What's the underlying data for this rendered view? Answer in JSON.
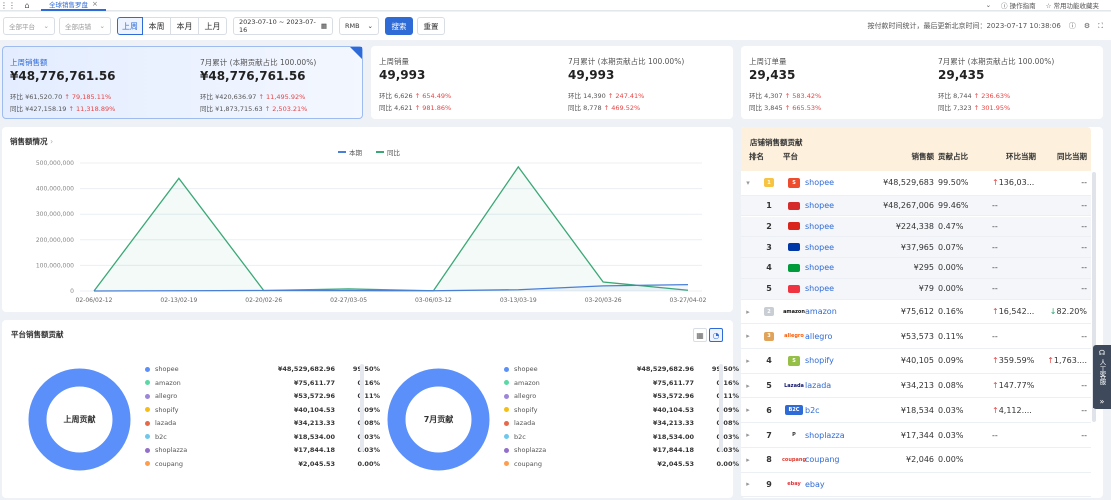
{
  "topbar": {
    "tab_title": "全球销售罗盘",
    "guide": "操作指南",
    "common_features": "常用功能收藏夹"
  },
  "filters": {
    "platform_placeholder": "全部平台",
    "shop_placeholder": "全部店铺",
    "periods": [
      "上周",
      "本周",
      "本月",
      "上月"
    ],
    "active_period": "上周",
    "date_range": "2023-07-10 ~ 2023-07-16",
    "currency": "RMB",
    "search": "搜索",
    "reset": "重置",
    "note": "按付款时间统计，最后更新北京时间：2023-07-17 10:38:06"
  },
  "kpis": [
    {
      "label": "上周销售额",
      "value": "¥48,776,761.56",
      "hb_label": "环比",
      "hb_prev": "¥61,520.70",
      "hb_change": "79,185.11%",
      "tb_label": "同比",
      "tb_prev": "¥427,158.19",
      "tb_change": "11,318.89%",
      "m_label": "7月累计 (本期贡献占比 100.00%)",
      "m_value": "¥48,776,761.56",
      "m_hb_prev": "¥420,636.97",
      "m_hb_change": "11,495.92%",
      "m_tb_prev": "¥1,873,715.63",
      "m_tb_change": "2,503.21%"
    },
    {
      "label": "上周销量",
      "value": "49,993",
      "hb_label": "环比",
      "hb_prev": "6,626",
      "hb_change": "654.49%",
      "tb_label": "同比",
      "tb_prev": "4,621",
      "tb_change": "981.86%",
      "m_label": "7月累计 (本期贡献占比 100.00%)",
      "m_value": "49,993",
      "m_hb_prev": "14,390",
      "m_hb_change": "247.41%",
      "m_tb_prev": "8,778",
      "m_tb_change": "469.52%"
    },
    {
      "label": "上周订单量",
      "value": "29,435",
      "hb_label": "环比",
      "hb_prev": "4,307",
      "hb_change": "583.42%",
      "tb_label": "同比",
      "tb_prev": "3,845",
      "tb_change": "665.53%",
      "m_label": "7月累计 (本期贡献占比 100.00%)",
      "m_value": "29,435",
      "m_hb_prev": "8,744",
      "m_hb_change": "236.63%",
      "m_tb_prev": "7,323",
      "m_tb_change": "301.95%"
    }
  ],
  "sales_chart": {
    "title": "销售额情况",
    "chart_data": {
      "type": "line",
      "x": [
        "02-06/02-12",
        "02-13/02-19",
        "02-20/02-26",
        "02-27/03-05",
        "03-06/03-12",
        "03-13/03-19",
        "03-20/03-26",
        "03-27/04-02"
      ],
      "ylim": [
        0,
        500000000
      ],
      "yticks": [
        "500,000,000",
        "400,000,000",
        "300,000,000",
        "200,000,000",
        "100,000,000",
        "0"
      ],
      "series": [
        {
          "name": "本期",
          "color": "#4a7fd6",
          "values": [
            0,
            1000000,
            2000000,
            1500000,
            1000000,
            5000000,
            20000000,
            25000000
          ]
        },
        {
          "name": "同比",
          "color": "#3aa876",
          "values": [
            0,
            440000000,
            2000000,
            8000000,
            1000000,
            485000000,
            35000000,
            3000000
          ]
        }
      ]
    }
  },
  "platform": {
    "title": "平台销售额贡献",
    "donut1_label": "上周贡献",
    "donut2_label": "7月贡献",
    "items": [
      {
        "name": "shopee",
        "color": "#5b8ff9",
        "amount": "¥48,529,682.96",
        "pct": "99.50%"
      },
      {
        "name": "amazon",
        "color": "#5ad8a6",
        "amount": "¥75,611.77",
        "pct": "0.16%"
      },
      {
        "name": "allegro",
        "color": "#9c86d9",
        "amount": "¥53,572.96",
        "pct": "0.11%"
      },
      {
        "name": "shopify",
        "color": "#f6bd16",
        "amount": "¥40,104.53",
        "pct": "0.09%"
      },
      {
        "name": "lazada",
        "color": "#e8684a",
        "amount": "¥34,213.33",
        "pct": "0.08%"
      },
      {
        "name": "b2c",
        "color": "#6dc8ec",
        "amount": "¥18,534.00",
        "pct": "0.03%"
      },
      {
        "name": "shoplazza",
        "color": "#9270ca",
        "amount": "¥17,844.18",
        "pct": "0.03%"
      },
      {
        "name": "coupang",
        "color": "#ff9d4d",
        "amount": "¥2,045.53",
        "pct": "0.00%"
      }
    ]
  },
  "shops": {
    "title": "店铺销售额贡献",
    "headers": [
      "排名",
      "平台",
      "销售额",
      "贡献占比",
      "环比当期",
      "同比当期"
    ],
    "rows": [
      {
        "rank": "1",
        "name": "shopee",
        "amount": "¥48,529,683",
        "share": "99.50%",
        "hb": "136,03...",
        "yb": "--",
        "sub": false,
        "exp": "▾",
        "logo": "S",
        "logobg": "#ee4d2d",
        "logofg": "#fff",
        "hbdir": "up"
      },
      {
        "rank": "1",
        "name": "shopee",
        "amount": "¥48,267,006",
        "share": "99.46%",
        "hb": "--",
        "yb": "--",
        "sub": true,
        "logobg": "#d62b2b"
      },
      {
        "rank": "2",
        "name": "shopee",
        "amount": "¥224,338",
        "share": "0.47%",
        "hb": "--",
        "yb": "--",
        "sub": true,
        "logobg": "#da251d"
      },
      {
        "rank": "3",
        "name": "shopee",
        "amount": "¥37,965",
        "share": "0.07%",
        "hb": "--",
        "yb": "--",
        "sub": true,
        "logobg": "#0038a8"
      },
      {
        "rank": "4",
        "name": "shopee",
        "amount": "¥295",
        "share": "0.00%",
        "hb": "--",
        "yb": "--",
        "sub": true,
        "logobg": "#009b3a"
      },
      {
        "rank": "5",
        "name": "shopee",
        "amount": "¥79",
        "share": "0.00%",
        "hb": "--",
        "yb": "--",
        "sub": true,
        "logobg": "#ef3340"
      },
      {
        "rank": "2",
        "name": "amazon",
        "amount": "¥75,612",
        "share": "0.16%",
        "hb": "16,542...",
        "yb": "82.20%",
        "sub": false,
        "exp": "▸",
        "logo": "amazon",
        "logobg": "#fff",
        "logofg": "#111",
        "hbdir": "up",
        "ybdir": "down"
      },
      {
        "rank": "3",
        "name": "allegro",
        "amount": "¥53,573",
        "share": "0.11%",
        "hb": "--",
        "yb": "--",
        "sub": false,
        "exp": "▸",
        "logo": "allegro",
        "logobg": "#fff",
        "logofg": "#ff5a00"
      },
      {
        "rank": "4",
        "name": "shopify",
        "amount": "¥40,105",
        "share": "0.09%",
        "hb": "359.59%",
        "yb": "1,763....",
        "sub": false,
        "exp": "▸",
        "logo": "S",
        "logobg": "#95bf47",
        "logofg": "#fff",
        "hbdir": "up",
        "ybdir": "up"
      },
      {
        "rank": "5",
        "name": "lazada",
        "amount": "¥34,213",
        "share": "0.08%",
        "hb": "147.77%",
        "yb": "--",
        "sub": false,
        "exp": "▸",
        "logo": "Lazada",
        "logobg": "#fff",
        "logofg": "#0f146d",
        "hbdir": "up"
      },
      {
        "rank": "6",
        "name": "b2c",
        "amount": "¥18,534",
        "share": "0.03%",
        "hb": "4,112....",
        "yb": "--",
        "sub": false,
        "exp": "▸",
        "logo": "B2C",
        "logobg": "#2f6bd6",
        "logofg": "#fff",
        "hbdir": "up"
      },
      {
        "rank": "7",
        "name": "shoplazza",
        "amount": "¥17,344",
        "share": "0.03%",
        "hb": "--",
        "yb": "--",
        "sub": false,
        "exp": "▸",
        "logo": "P",
        "logobg": "#fff",
        "logofg": "#333"
      },
      {
        "rank": "8",
        "name": "coupang",
        "amount": "¥2,046",
        "share": "0.00%",
        "hb": "",
        "yb": "",
        "sub": false,
        "exp": "▸",
        "logo": "coupang",
        "logobg": "#fff",
        "logofg": "#e03a2e"
      },
      {
        "rank": "9",
        "name": "ebay",
        "amount": "",
        "share": "",
        "hb": "",
        "yb": "",
        "sub": false,
        "exp": "▸",
        "logo": "ebay",
        "logobg": "#fff",
        "logofg": "#e53238"
      }
    ]
  }
}
